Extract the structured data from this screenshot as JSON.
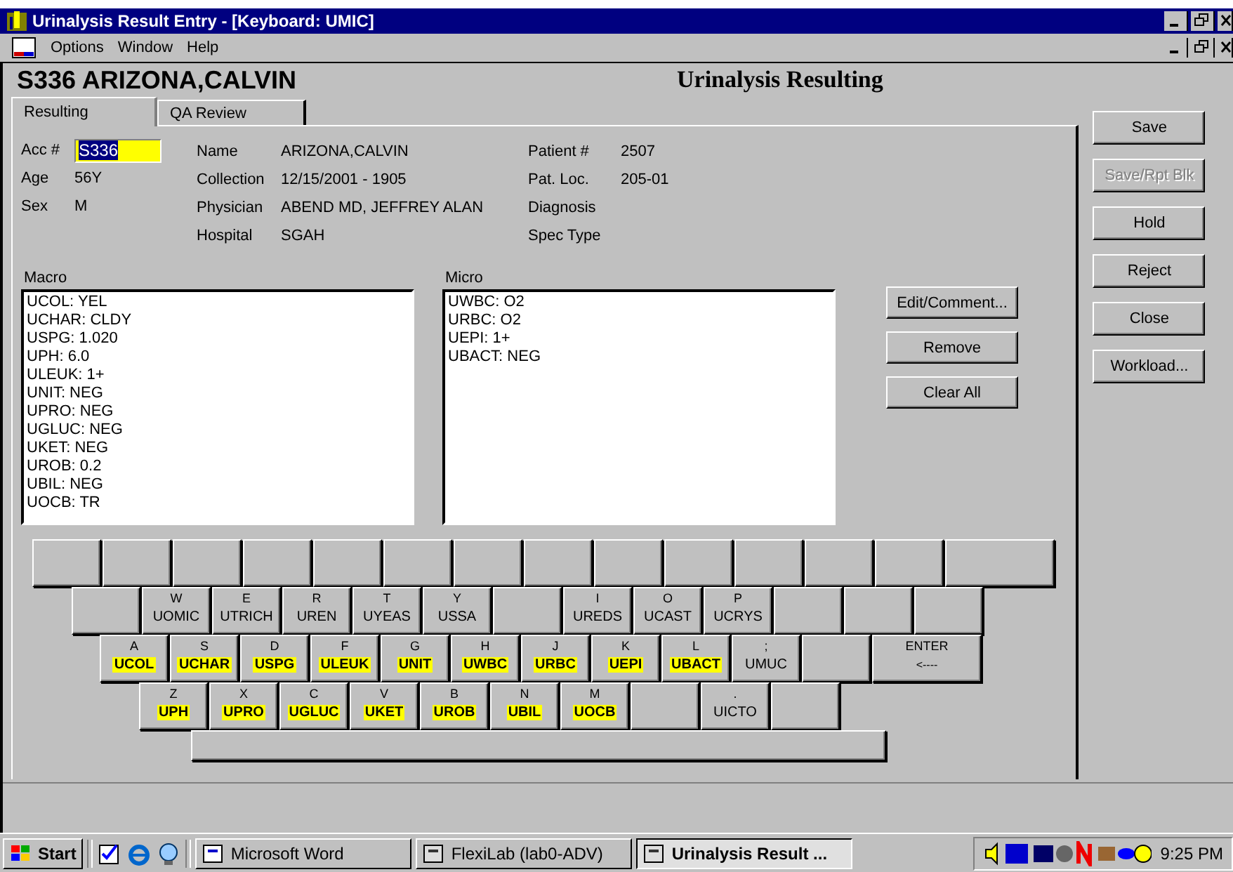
{
  "window": {
    "title": "Urinalysis Result Entry - [Keyboard: UMIC]"
  },
  "menu": [
    "Options",
    "Window",
    "Help"
  ],
  "header": {
    "patient": "S336 ARIZONA,CALVIN",
    "title": "Urinalysis Resulting"
  },
  "tabs": [
    {
      "label": "Resulting",
      "selected": true
    },
    {
      "label": "QA Review",
      "selected": false
    }
  ],
  "accession": {
    "label": "Acc #",
    "value": "S336"
  },
  "left_fields": [
    {
      "label": "Age",
      "value": "56Y"
    },
    {
      "label": "Sex",
      "value": "M"
    }
  ],
  "middle_fields": [
    {
      "label": "Name",
      "value": "ARIZONA,CALVIN"
    },
    {
      "label": "Collection",
      "value": "12/15/2001 - 1905"
    },
    {
      "label": "Physician",
      "value": "ABEND MD, JEFFREY ALAN"
    },
    {
      "label": "Hospital",
      "value": "SGAH"
    }
  ],
  "right_fields": [
    {
      "label": "Patient #",
      "value": "2507"
    },
    {
      "label": "Pat. Loc.",
      "value": "205-01"
    },
    {
      "label": "Diagnosis"
    },
    {
      "label": "Spec Type"
    }
  ],
  "macro": {
    "label": "Macro",
    "items": [
      "UCOL: YEL",
      "UCHAR: CLDY",
      "USPG: 1.020",
      "UPH: 6.0",
      "ULEUK: 1+",
      "UNIT: NEG",
      "UPRO: NEG",
      "UGLUC: NEG",
      "UKET: NEG",
      "UROB: 0.2",
      "UBIL: NEG",
      "UOCB: TR"
    ]
  },
  "micro": {
    "label": "Micro",
    "items": [
      "UWBC: O2",
      "URBC: O2",
      "UEPI: 1+",
      "UBACT: NEG"
    ]
  },
  "list_buttons": [
    "Edit/Comment...",
    "Remove",
    "Clear All"
  ],
  "side_buttons": [
    {
      "label": "Save",
      "disabled": false
    },
    {
      "label": "Save/Rpt Blk",
      "disabled": true
    },
    {
      "label": "Hold",
      "disabled": false
    },
    {
      "label": "Reject",
      "disabled": false
    },
    {
      "label": "Close",
      "disabled": false
    },
    {
      "label": "Workload...",
      "disabled": false
    }
  ],
  "keyboard": [
    [
      {
        "kind": "blank"
      },
      {
        "kind": "blank"
      },
      {
        "kind": "blank"
      },
      {
        "kind": "blank"
      },
      {
        "kind": "blank"
      },
      {
        "kind": "blank"
      },
      {
        "kind": "blank"
      },
      {
        "kind": "blank"
      },
      {
        "kind": "blank"
      },
      {
        "kind": "blank"
      },
      {
        "kind": "blank"
      },
      {
        "kind": "blank"
      },
      {
        "kind": "blank"
      },
      {
        "kind": "wide"
      }
    ],
    [
      {
        "kind": "blank"
      },
      {
        "kind": "code",
        "letter": "W",
        "code": "UOMIC",
        "highlighted": false
      },
      {
        "kind": "code",
        "letter": "E",
        "code": "UTRICH",
        "highlighted": false
      },
      {
        "kind": "code",
        "letter": "R",
        "code": "UREN",
        "highlighted": false
      },
      {
        "kind": "code",
        "letter": "T",
        "code": "UYEAS",
        "highlighted": false
      },
      {
        "kind": "code",
        "letter": "Y",
        "code": "USSA",
        "highlighted": false
      },
      {
        "kind": "blank"
      },
      {
        "kind": "code",
        "letter": "I",
        "code": "UREDS",
        "highlighted": false
      },
      {
        "kind": "code",
        "letter": "O",
        "code": "UCAST",
        "highlighted": false
      },
      {
        "kind": "code",
        "letter": "P",
        "code": "UCRYS",
        "highlighted": false
      },
      {
        "kind": "blank"
      },
      {
        "kind": "blank"
      },
      {
        "kind": "blank"
      }
    ],
    [
      {
        "kind": "code",
        "letter": "A",
        "code": "UCOL",
        "highlighted": true
      },
      {
        "kind": "code",
        "letter": "S",
        "code": "UCHAR",
        "highlighted": true
      },
      {
        "kind": "code",
        "letter": "D",
        "code": "USPG",
        "highlighted": true
      },
      {
        "kind": "code",
        "letter": "F",
        "code": "ULEUK",
        "highlighted": true
      },
      {
        "kind": "code",
        "letter": "G",
        "code": "UNIT",
        "highlighted": true
      },
      {
        "kind": "code",
        "letter": "H",
        "code": "UWBC",
        "highlighted": true
      },
      {
        "kind": "code",
        "letter": "J",
        "code": "URBC",
        "highlighted": true
      },
      {
        "kind": "code",
        "letter": "K",
        "code": "UEPI",
        "highlighted": true
      },
      {
        "kind": "code",
        "letter": "L",
        "code": "UBACT",
        "highlighted": true
      },
      {
        "kind": "code",
        "letter": ";",
        "code": "UMUC",
        "highlighted": false
      },
      {
        "kind": "blank"
      },
      {
        "kind": "enter",
        "letter": "ENTER",
        "code": "<----"
      }
    ],
    [
      {
        "kind": "code",
        "letter": "Z",
        "code": "UPH",
        "highlighted": true
      },
      {
        "kind": "code",
        "letter": "X",
        "code": "UPRO",
        "highlighted": true
      },
      {
        "kind": "code",
        "letter": "C",
        "code": "UGLUC",
        "highlighted": true
      },
      {
        "kind": "code",
        "letter": "V",
        "code": "UKET",
        "highlighted": true
      },
      {
        "kind": "code",
        "letter": "B",
        "code": "UROB",
        "highlighted": true
      },
      {
        "kind": "code",
        "letter": "N",
        "code": "UBIL",
        "highlighted": true
      },
      {
        "kind": "code",
        "letter": "M",
        "code": "UOCB",
        "highlighted": true
      },
      {
        "kind": "blank"
      },
      {
        "kind": "code",
        "letter": ".",
        "code": "UICTO",
        "highlighted": false
      },
      {
        "kind": "blank"
      }
    ]
  ],
  "taskbar": {
    "start": "Start",
    "tasks": [
      {
        "label": "Microsoft Word",
        "selected": false
      },
      {
        "label": "FlexiLab (lab0-ADV)",
        "selected": false
      },
      {
        "label": "Urinalysis Result ...",
        "selected": true
      }
    ],
    "clock": "9:25 PM"
  }
}
